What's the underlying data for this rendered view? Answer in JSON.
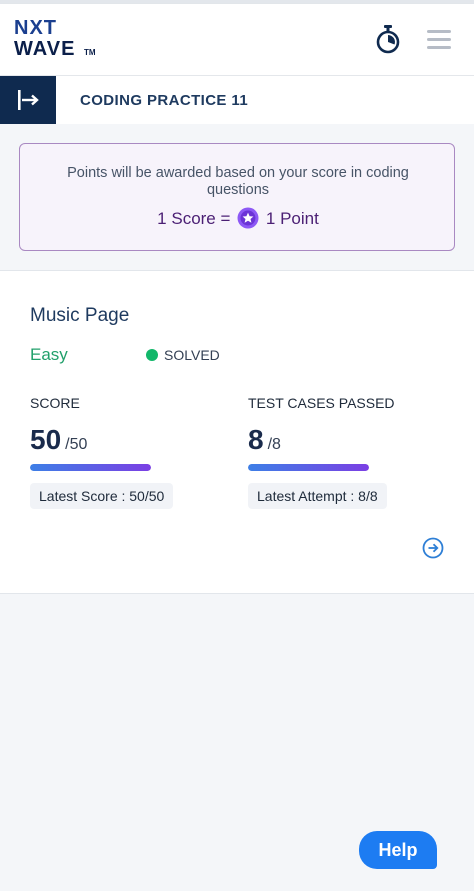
{
  "header": {
    "logo_line1": "NXT",
    "logo_line2": "WAVE",
    "logo_tm": "TM"
  },
  "page": {
    "title": "CODING PRACTICE 11"
  },
  "points_info": {
    "message": "Points will be awarded based on your score in coding questions",
    "equation_left": "1 Score =",
    "equation_right": "1 Point"
  },
  "problem": {
    "title": "Music Page",
    "difficulty": "Easy",
    "status": "SOLVED",
    "score": {
      "label": "SCORE",
      "value": "50",
      "total": "/50",
      "progress": 1.0,
      "latest": "Latest Score : 50/50"
    },
    "tests": {
      "label": "TEST CASES PASSED",
      "value": "8",
      "total": "/8",
      "progress": 1.0,
      "latest": "Latest Attempt : 8/8"
    }
  },
  "help": {
    "label": "Help"
  },
  "colors": {
    "brand_dark": "#0f2a4f",
    "accent_purple": "#4b1f74",
    "difficulty_easy": "#22a06b",
    "solved_green": "#12b76a",
    "help_blue": "#1d7cf2"
  },
  "icons": {
    "timer": "stopwatch-icon",
    "menu": "hamburger-menu-icon",
    "sidebar_toggle": "collapse-sidebar-icon",
    "coin": "star-coin-icon",
    "open": "arrow-right-circle-icon"
  }
}
